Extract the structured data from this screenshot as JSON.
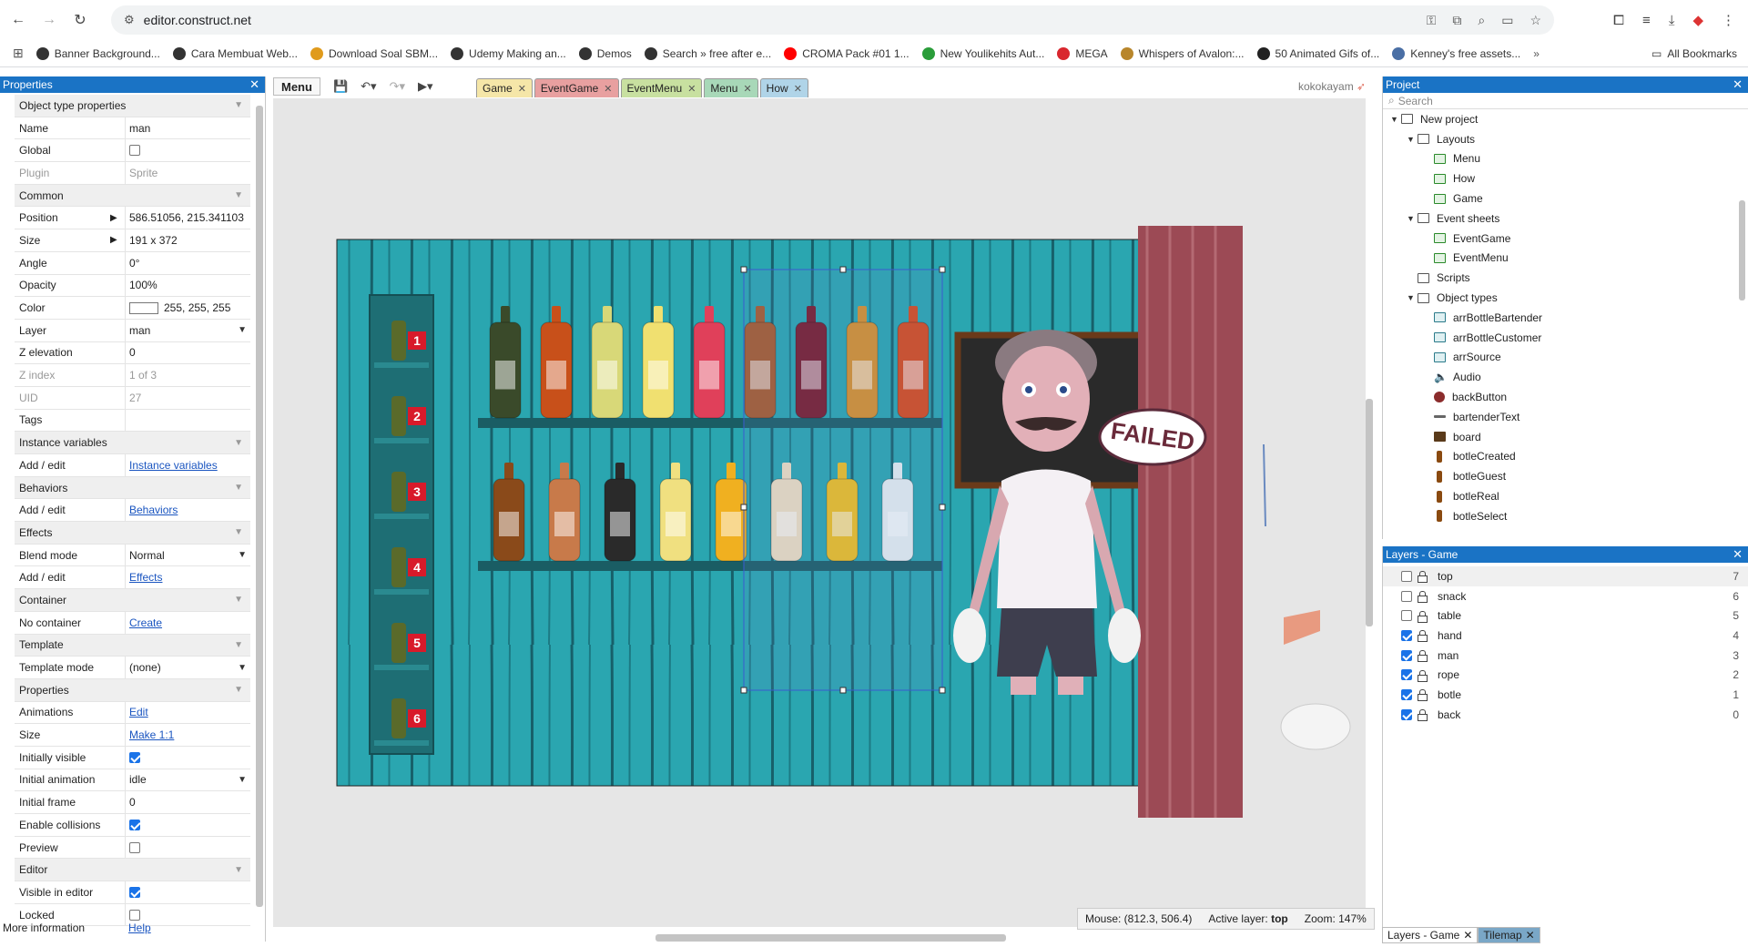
{
  "browser": {
    "url": "editor.construct.net",
    "bookmarks": [
      {
        "label": "Banner Background...",
        "color": "#333333"
      },
      {
        "label": "Cara Membuat Web...",
        "color": "#333333"
      },
      {
        "label": "Download Soal SBM...",
        "color": "#e09b1c"
      },
      {
        "label": "Udemy Making an...",
        "color": "#333333"
      },
      {
        "label": "Demos",
        "color": "#333333"
      },
      {
        "label": "Search » free after e...",
        "color": "#333333"
      },
      {
        "label": "CROMA Pack #01 1...",
        "color": "#ff0000"
      },
      {
        "label": "New Youlikehits Aut...",
        "color": "#2a9d3a"
      },
      {
        "label": "MEGA",
        "color": "#d9272e"
      },
      {
        "label": "Whispers of Avalon:...",
        "color": "#b8862b"
      },
      {
        "label": "50 Animated Gifs of...",
        "color": "#222222"
      },
      {
        "label": "Kenney's free assets...",
        "color": "#4a6fa5"
      }
    ],
    "all_bookmarks": "All Bookmarks"
  },
  "properties": {
    "title": "Properties",
    "rows": [
      {
        "type": "cat",
        "k": "Object type properties"
      },
      {
        "type": "text",
        "k": "Name",
        "v": "man"
      },
      {
        "type": "check",
        "k": "Global",
        "checked": false
      },
      {
        "type": "grey",
        "k": "Plugin",
        "v": "Sprite"
      },
      {
        "type": "cat",
        "k": "Common"
      },
      {
        "type": "expand",
        "k": "Position",
        "v": "586.51056, 215.341103"
      },
      {
        "type": "expand",
        "k": "Size",
        "v": "191 x 372"
      },
      {
        "type": "text",
        "k": "Angle",
        "v": "0°"
      },
      {
        "type": "text",
        "k": "Opacity",
        "v": "100%"
      },
      {
        "type": "color",
        "k": "Color",
        "v": "255, 255, 255"
      },
      {
        "type": "select",
        "k": "Layer",
        "v": "man"
      },
      {
        "type": "text",
        "k": "Z elevation",
        "v": "0"
      },
      {
        "type": "grey",
        "k": "Z index",
        "v": "1 of 3"
      },
      {
        "type": "grey",
        "k": "UID",
        "v": "27"
      },
      {
        "type": "text",
        "k": "Tags",
        "v": ""
      },
      {
        "type": "cat",
        "k": "Instance variables"
      },
      {
        "type": "link",
        "k": "Add / edit",
        "v": "Instance variables"
      },
      {
        "type": "cat",
        "k": "Behaviors"
      },
      {
        "type": "link",
        "k": "Add / edit",
        "v": "Behaviors"
      },
      {
        "type": "cat",
        "k": "Effects"
      },
      {
        "type": "select",
        "k": "Blend mode",
        "v": "Normal"
      },
      {
        "type": "link",
        "k": "Add / edit",
        "v": "Effects"
      },
      {
        "type": "cat",
        "k": "Container"
      },
      {
        "type": "link",
        "k": "No container",
        "v": "Create"
      },
      {
        "type": "cat",
        "k": "Template"
      },
      {
        "type": "select",
        "k": "Template mode",
        "v": "(none)"
      },
      {
        "type": "cat",
        "k": "Properties"
      },
      {
        "type": "link",
        "k": "Animations",
        "v": "Edit"
      },
      {
        "type": "link",
        "k": "Size",
        "v": "Make 1:1"
      },
      {
        "type": "check",
        "k": "Initially visible",
        "checked": true
      },
      {
        "type": "select",
        "k": "Initial animation",
        "v": "idle"
      },
      {
        "type": "text",
        "k": "Initial frame",
        "v": "0"
      },
      {
        "type": "check",
        "k": "Enable collisions",
        "checked": true
      },
      {
        "type": "check",
        "k": "Preview",
        "checked": false
      },
      {
        "type": "cat",
        "k": "Editor"
      },
      {
        "type": "check",
        "k": "Visible in editor",
        "checked": true
      },
      {
        "type": "check",
        "k": "Locked",
        "checked": false
      }
    ],
    "more_info": "More information",
    "help": "Help"
  },
  "editor": {
    "menu": "Menu",
    "tabs": [
      {
        "label": "Game",
        "bg": "#f5e6a8"
      },
      {
        "label": "EventGame",
        "bg": "#e8a0a0"
      },
      {
        "label": "EventMenu",
        "bg": "#c8e0a0"
      },
      {
        "label": "Menu",
        "bg": "#a8d8b8"
      },
      {
        "label": "How",
        "bg": "#b0d4e8"
      }
    ],
    "user": "kokokayam",
    "sign_text": "FAILED",
    "shelf_numbers": [
      "1",
      "2",
      "3",
      "4",
      "5",
      "6"
    ],
    "status": {
      "mouse": "Mouse: (812.3, 506.4)",
      "active_label": "Active layer:",
      "active_value": "top",
      "zoom": "Zoom: 147%"
    }
  },
  "project": {
    "title": "Project",
    "search_placeholder": "Search",
    "tree": [
      {
        "label": "New project",
        "indent": 0,
        "icon": "folder",
        "tri": "▼"
      },
      {
        "label": "Layouts",
        "indent": 1,
        "icon": "folder",
        "tri": "▼"
      },
      {
        "label": "Menu",
        "indent": 2,
        "icon": "layout",
        "tri": ""
      },
      {
        "label": "How",
        "indent": 2,
        "icon": "layout",
        "tri": ""
      },
      {
        "label": "Game",
        "indent": 2,
        "icon": "layout",
        "tri": ""
      },
      {
        "label": "Event sheets",
        "indent": 1,
        "icon": "folder",
        "tri": "▼"
      },
      {
        "label": "EventGame",
        "indent": 2,
        "icon": "sheet",
        "tri": ""
      },
      {
        "label": "EventMenu",
        "indent": 2,
        "icon": "sheet",
        "tri": ""
      },
      {
        "label": "Scripts",
        "indent": 1,
        "icon": "folder",
        "tri": ""
      },
      {
        "label": "Object types",
        "indent": 1,
        "icon": "folder",
        "tri": "▼"
      },
      {
        "label": "arrBottleBartender",
        "indent": 2,
        "icon": "arr",
        "tri": ""
      },
      {
        "label": "arrBottleCustomer",
        "indent": 2,
        "icon": "arr",
        "tri": ""
      },
      {
        "label": "arrSource",
        "indent": 2,
        "icon": "arr",
        "tri": ""
      },
      {
        "label": "Audio",
        "indent": 2,
        "icon": "audio",
        "tri": ""
      },
      {
        "label": "backButton",
        "indent": 2,
        "icon": "sprite",
        "tri": ""
      },
      {
        "label": "bartenderText",
        "indent": 2,
        "icon": "text",
        "tri": ""
      },
      {
        "label": "board",
        "indent": 2,
        "icon": "board",
        "tri": ""
      },
      {
        "label": "botleCreated",
        "indent": 2,
        "icon": "bottle",
        "tri": ""
      },
      {
        "label": "botleGuest",
        "indent": 2,
        "icon": "bottle",
        "tri": ""
      },
      {
        "label": "botleReal",
        "indent": 2,
        "icon": "bottle",
        "tri": ""
      },
      {
        "label": "botleSelect",
        "indent": 2,
        "icon": "bottle",
        "tri": ""
      }
    ]
  },
  "layers": {
    "title": "Layers - Game",
    "rows": [
      {
        "name": "top",
        "num": "7",
        "checked": false
      },
      {
        "name": "snack",
        "num": "6",
        "checked": false
      },
      {
        "name": "table",
        "num": "5",
        "checked": false
      },
      {
        "name": "hand",
        "num": "4",
        "checked": true
      },
      {
        "name": "man",
        "num": "3",
        "checked": true
      },
      {
        "name": "rope",
        "num": "2",
        "checked": true
      },
      {
        "name": "botle",
        "num": "1",
        "checked": true
      },
      {
        "name": "back",
        "num": "0",
        "checked": true
      }
    ],
    "tabs": [
      "Layers - Game",
      "Tilemap"
    ]
  }
}
